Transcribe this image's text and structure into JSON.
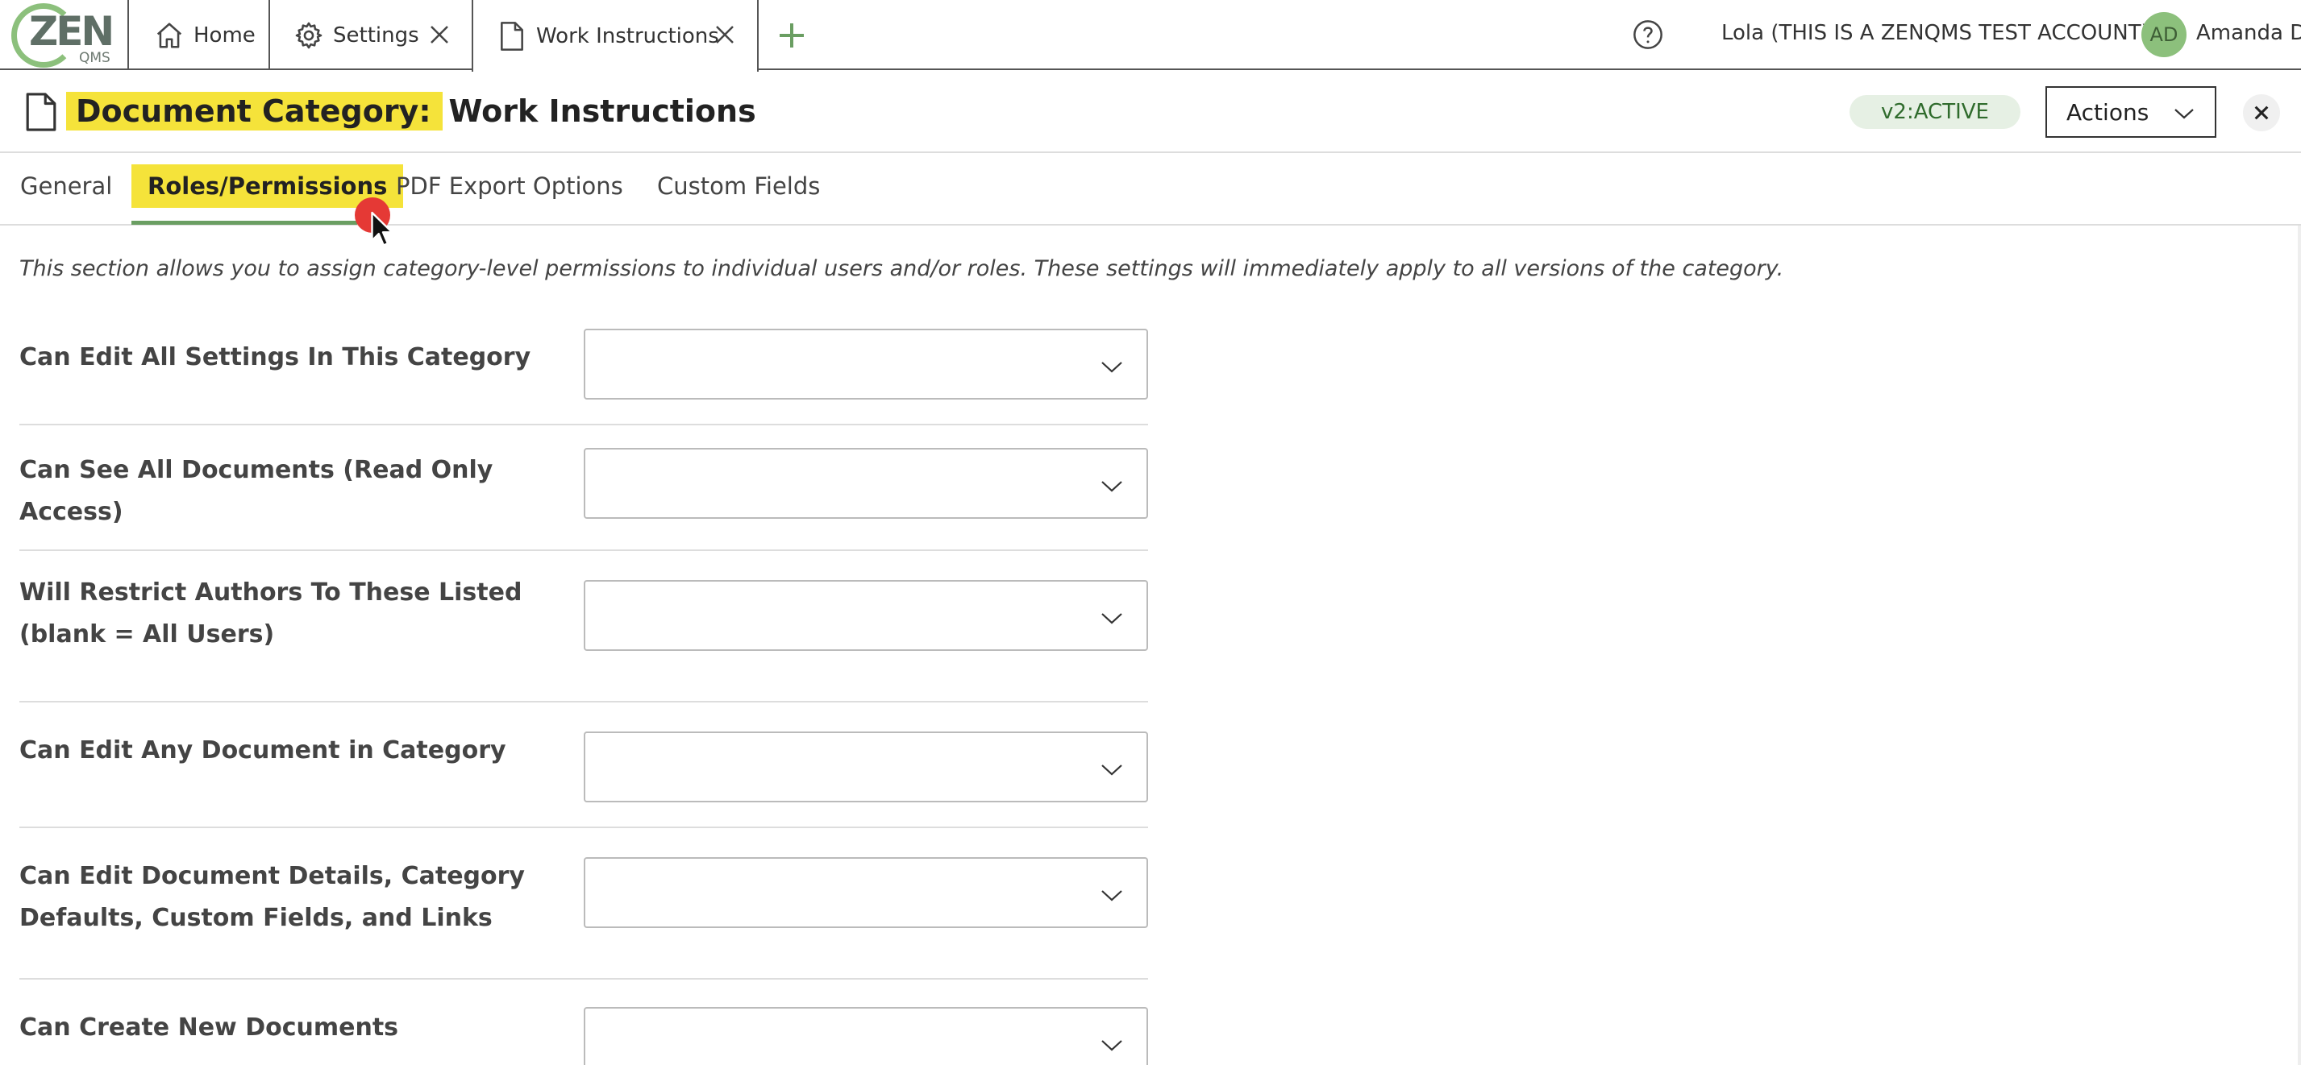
{
  "logo": {
    "main": "ZEN",
    "sub": "QMS"
  },
  "tabs": [
    {
      "label": "Home",
      "icon": "home-icon"
    },
    {
      "label": "Settings",
      "icon": "gear-icon"
    },
    {
      "label": "Work Instructions",
      "icon": "document-icon"
    }
  ],
  "topbar": {
    "account": "Lola (THIS IS A ZENQMS TEST ACCOUNT)",
    "avatar_initials": "AD",
    "user": "Amanda D"
  },
  "header": {
    "title_prefix": "Document Category:",
    "title_name": "Work Instructions",
    "status": "v2:ACTIVE",
    "actions_label": "Actions"
  },
  "subtabs": [
    "General",
    "Roles/Permissions",
    "PDF Export Options",
    "Custom Fields"
  ],
  "intro": "This section allows you to assign category-level permissions to individual users and/or roles. These settings will immediately apply to all versions of the category.",
  "permissions": [
    {
      "label": "Can Edit All Settings In This Category",
      "value": ""
    },
    {
      "label": "Can See All Documents (Read Only Access)",
      "value": ""
    },
    {
      "label": "Will Restrict Authors To These Listed (blank = All Users)",
      "value": ""
    },
    {
      "label": "Can Edit Any Document in Category",
      "value": ""
    },
    {
      "label": "Can Edit Document Details, Category Defaults, Custom Fields, and Links",
      "value": ""
    },
    {
      "label": "Can Create New Documents",
      "value": ""
    }
  ],
  "colors": {
    "highlight": "#f5e33a",
    "brand_green": "#8cc07c",
    "active_underline": "#6a9e62",
    "status_bg": "#e6f0e4"
  }
}
